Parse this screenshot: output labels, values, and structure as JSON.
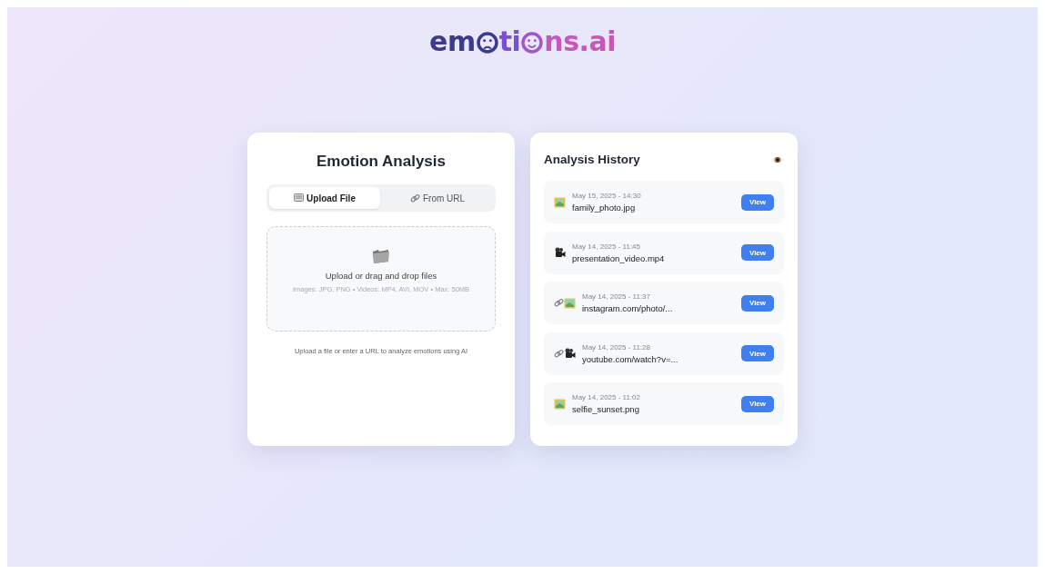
{
  "logo": {
    "parts": [
      "em",
      "ti",
      "ns.ai"
    ]
  },
  "analysis": {
    "title": "Emotion Analysis",
    "tabs": [
      {
        "label": "Upload File",
        "selected": true
      },
      {
        "label": "From URL",
        "selected": false
      }
    ],
    "dropzone": {
      "title": "Upload or drag and drop files",
      "hint": "Images: JPG, PNG • Videos: MP4, AVI, MOV • Max: 50MB"
    },
    "footer": "Upload a file or enter a URL to analyze emotions using AI"
  },
  "history": {
    "title": "Analysis History",
    "items": [
      {
        "kind": "image",
        "date": "May 15, 2025 - 14:30",
        "name": "family_photo.jpg",
        "button": "View"
      },
      {
        "kind": "video",
        "date": "May 14, 2025 - 11:45",
        "name": "presentation_video.mp4",
        "button": "View"
      },
      {
        "kind": "linkimage",
        "date": "May 14, 2025 - 11:37",
        "name": "instagram.com/photo/...",
        "button": "View"
      },
      {
        "kind": "linkvideo",
        "date": "May 14, 2025 - 11:28",
        "name": "youtube.com/watch?v=...",
        "button": "View"
      },
      {
        "kind": "image",
        "date": "May 14, 2025 - 11:02",
        "name": "selfie_sunset.png",
        "button": "View"
      }
    ]
  }
}
